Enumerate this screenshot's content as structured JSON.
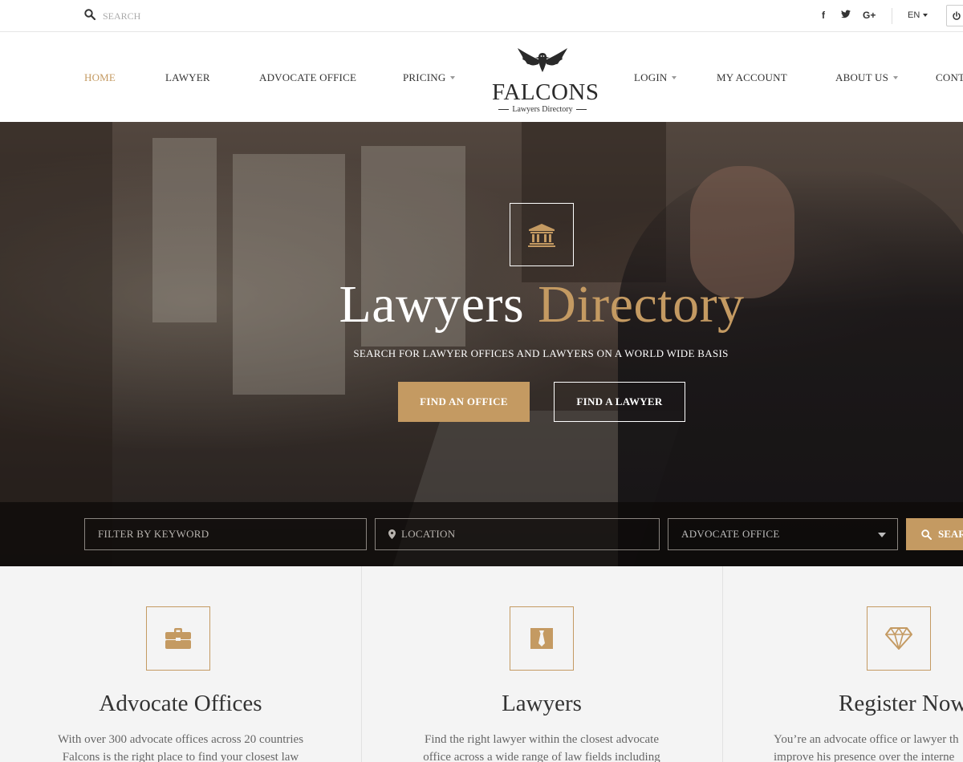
{
  "topbar": {
    "search_placeholder": "SEARCH",
    "social": [
      "f",
      "t",
      "G+"
    ],
    "language": "EN"
  },
  "nav": {
    "items": [
      {
        "label": "HOME",
        "active": true
      },
      {
        "label": "LAWYER"
      },
      {
        "label": "ADVOCATE OFFICE"
      },
      {
        "label": "PRICING",
        "dropdown": true
      },
      {
        "label": "LOGIN",
        "dropdown": true
      },
      {
        "label": "MY ACCOUNT"
      },
      {
        "label": "ABOUT US",
        "dropdown": true
      },
      {
        "label": "CONT"
      }
    ],
    "logo": {
      "name": "FALCONS",
      "tagline": "Lawyers Directory"
    }
  },
  "hero": {
    "title_white": "Lawyers",
    "title_gold": "Directory",
    "subtitle": "SEARCH FOR LAWYER OFFICES AND LAWYERS ON A WORLD WIDE BASIS",
    "btn_office": "FIND AN OFFICE",
    "btn_lawyer": "FIND A LAWYER"
  },
  "filter": {
    "keyword_placeholder": "FILTER BY KEYWORD",
    "location_placeholder": "LOCATION",
    "category_selected": "ADVOCATE OFFICE",
    "search_label": "SEAR"
  },
  "features": [
    {
      "title": "Advocate Offices",
      "line1": "With over 300 advocate offices across 20 countries",
      "line2": "Falcons is the right place to find your closest law"
    },
    {
      "title": "Lawyers",
      "line1": "Find the right lawyer within the closest advocate",
      "line2": "office across a wide range of law fields including"
    },
    {
      "title": "Register Now",
      "line1": "You’re an advocate office or lawyer th",
      "line2": "improve his presence over the interne"
    }
  ],
  "colors": {
    "accent": "#c49a62",
    "text": "#333333",
    "panel": "#f4f4f4"
  }
}
